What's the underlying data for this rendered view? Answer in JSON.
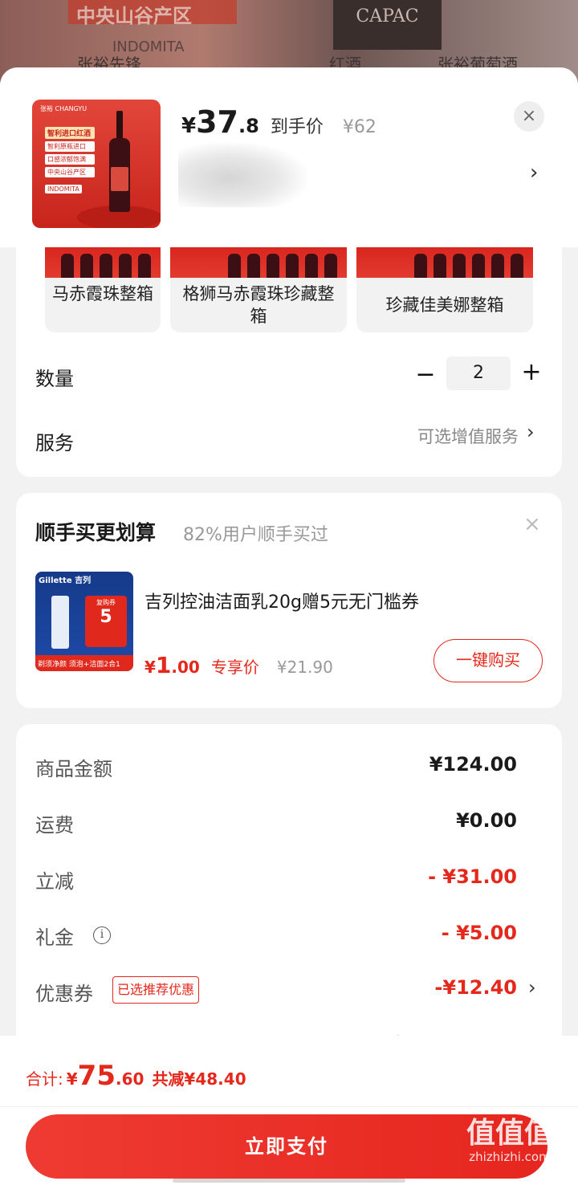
{
  "background": {
    "banner": "中央山谷产区",
    "brand": "INDOMITA",
    "capac": "CAPAC",
    "tabs": [
      "张裕先锋",
      "红酒",
      "张裕葡萄酒"
    ]
  },
  "header": {
    "price_yen": "¥",
    "price_int": "37",
    "price_dec": ".8",
    "price_label": "到手价",
    "price_orig": "¥62",
    "close": "×",
    "chevron": "›",
    "thumb": {
      "brand": "张裕 CHANGYU",
      "tags": [
        "智利进口红酒",
        "智利原瓶进口",
        "口感浓郁饱满",
        "中央山谷产区"
      ],
      "logo": "INDOMITA"
    }
  },
  "variants": [
    {
      "name": "马赤霞珠整箱"
    },
    {
      "name": "格狮马赤霞珠珍藏整箱"
    },
    {
      "name": "珍藏佳美娜整箱"
    }
  ],
  "quantity": {
    "label": "数量",
    "minus": "−",
    "value": "2",
    "plus": "+"
  },
  "service": {
    "label": "服务",
    "hint": "可选增值服务",
    "chevron": "›"
  },
  "upsell": {
    "title": "顺手买更划算",
    "subtitle": "82%用户顺手买过",
    "close": "×",
    "thumb": {
      "brand": "Gillette 吉列",
      "coupon_title": "复购券",
      "coupon_num": "5",
      "bar": "剃须净颜 须泡+洁面2合1"
    },
    "name": "吉列控油洁面乳20g赠5元无门槛券",
    "price_yen": "¥",
    "price_int": "1",
    "price_dec": ".00",
    "price_label": "专享价",
    "price_orig": "¥21.90",
    "button": "一键购买"
  },
  "summary": {
    "rows": [
      {
        "label": "商品金额",
        "value": "¥124.00"
      },
      {
        "label": "运费",
        "value": "¥0.00"
      },
      {
        "label": "立减",
        "value": "- ¥31.00"
      },
      {
        "label": "礼金",
        "value": "- ¥5.00"
      },
      {
        "label": "优惠券",
        "value": "-¥12.40"
      }
    ],
    "info_icon": "i",
    "coupon_badge": "已选推荐优惠",
    "coupon_chevron": "›",
    "peek": "品士不纸"
  },
  "bottom": {
    "total_label": "合计:",
    "total_yen": "¥",
    "total_int": "75",
    "total_dec": ".60",
    "save": "共减¥48.40",
    "pay": "立即支付",
    "watermark_big": "值值值",
    "watermark_small": "zhizhizhi.com"
  },
  "colors": {
    "accent": "#e5281c",
    "page_bg": "#f2f2f2"
  }
}
